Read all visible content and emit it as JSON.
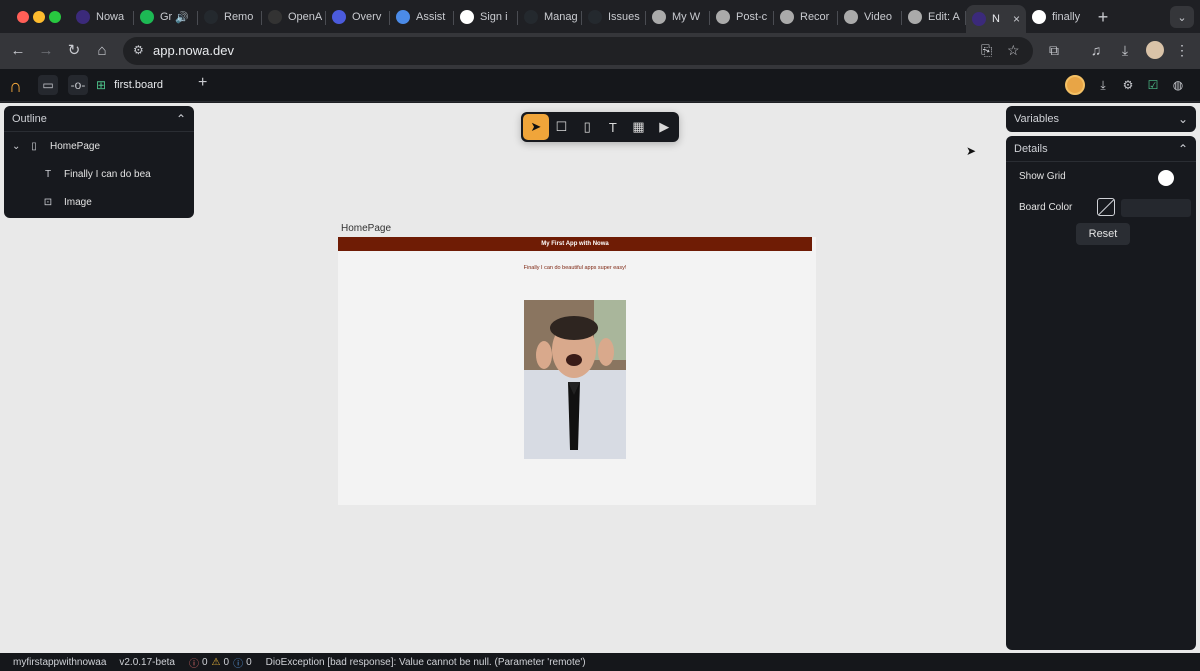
{
  "browser": {
    "tabs": [
      {
        "title": "Nowa",
        "icon": "nowa-icon",
        "color": "#3b2a7a"
      },
      {
        "title": "Gr",
        "icon": "spotify-icon",
        "color": "#1db954",
        "audio": "🔊"
      },
      {
        "title": "Remo",
        "icon": "github-icon",
        "color": "#24292e"
      },
      {
        "title": "OpenA",
        "icon": "openai-icon",
        "color": "#333"
      },
      {
        "title": "Overv",
        "icon": "overview-icon",
        "color": "#4b5bdc"
      },
      {
        "title": "Assist",
        "icon": "assist-icon",
        "color": "#4b8be8"
      },
      {
        "title": "Sign i",
        "icon": "google-icon",
        "color": "#fff"
      },
      {
        "title": "Manag",
        "icon": "github-icon",
        "color": "#24292e"
      },
      {
        "title": "Issues",
        "icon": "github-icon",
        "color": "#24292e"
      },
      {
        "title": "My W",
        "icon": "cloud-icon",
        "color": "#aaa"
      },
      {
        "title": "Post-c",
        "icon": "cloud-icon",
        "color": "#aaa"
      },
      {
        "title": "Recor",
        "icon": "cloud-icon",
        "color": "#aaa"
      },
      {
        "title": "Video",
        "icon": "cloud-icon",
        "color": "#aaa"
      },
      {
        "title": "Edit: A",
        "icon": "cloud-icon",
        "color": "#aaa"
      }
    ],
    "active_tab": {
      "title": "N",
      "close": "×"
    },
    "last_tab": {
      "title": "finally"
    },
    "new_tab": "+",
    "tab_menu": "⌄",
    "url": "app.nowa.dev"
  },
  "app": {
    "board_tab": "first.board",
    "add": "+"
  },
  "outline": {
    "title": "Outline",
    "chevron": "⌃",
    "items": [
      {
        "label": "HomePage",
        "icon": "phone-icon"
      },
      {
        "label": "Finally I can do bea",
        "icon": "text-icon"
      },
      {
        "label": "Image",
        "icon": "image-icon"
      }
    ]
  },
  "tools": {
    "select": "➤",
    "rect": "☐",
    "phone": "▯",
    "text": "T",
    "components": "▦",
    "play": "▶"
  },
  "page": {
    "label": "HomePage",
    "appbar_title": "My First App with Nowa",
    "body_text": "Finally I can do beautiful apps super easy!"
  },
  "variables": {
    "title": "Variables",
    "chevron": "⌄"
  },
  "details": {
    "title": "Details",
    "chevron": "⌃",
    "show_grid_label": "Show Grid",
    "board_color_label": "Board Color",
    "reset_label": "Reset"
  },
  "statusbar": {
    "project": "myfirstappwithnowaa",
    "version": "v2.0.17-beta",
    "errors": "0",
    "warnings": "0",
    "infos": "0",
    "message": "DioException [bad response]: Value cannot be null. (Parameter 'remote')"
  },
  "colors": {
    "accent": "#f0a53a",
    "appbar": "#6f1c05",
    "panel": "#17191e",
    "canvas": "#e9e9e9"
  }
}
